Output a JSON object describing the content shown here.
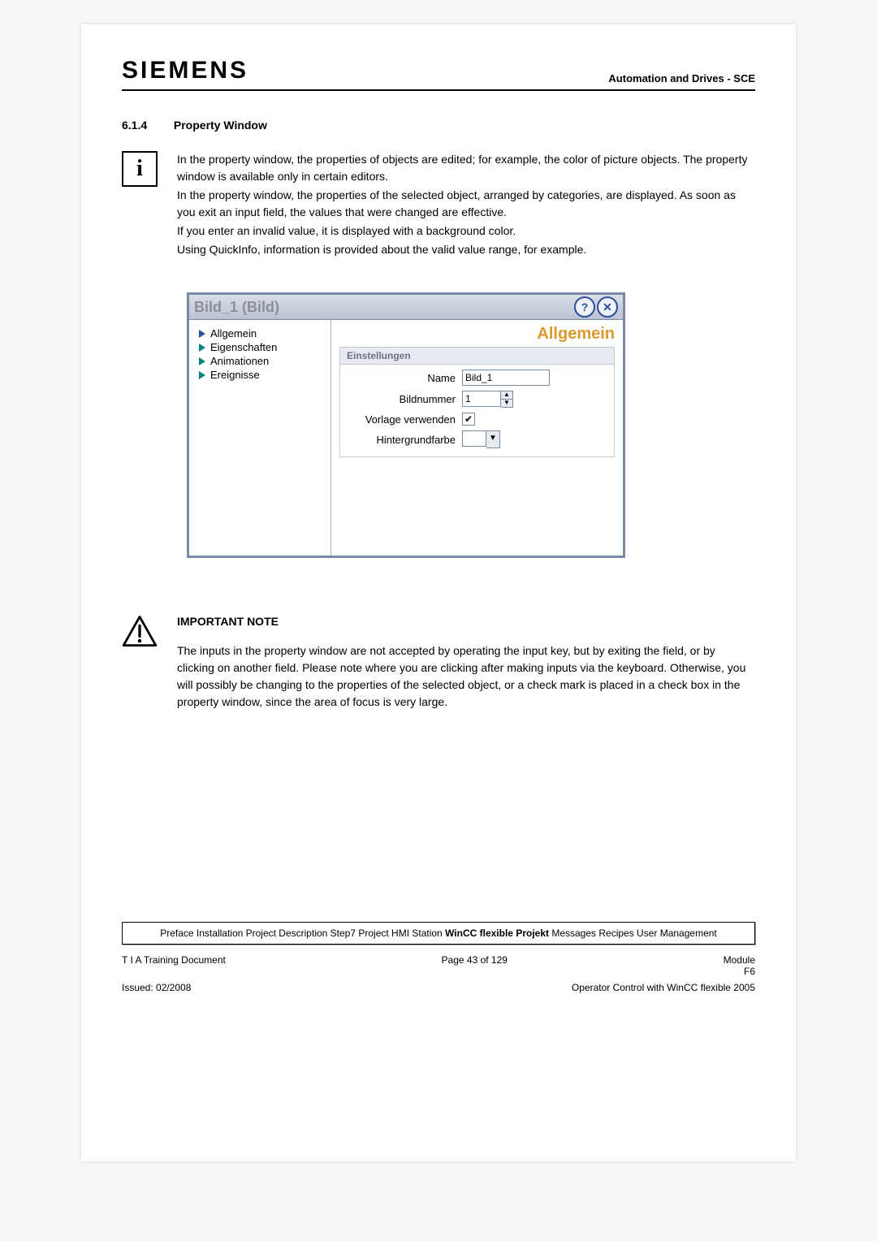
{
  "header": {
    "logo": "SIEMENS",
    "right": "Automation and Drives - SCE"
  },
  "section": {
    "number": "6.1.4",
    "title": "Property Window"
  },
  "info_icon": "i",
  "paragraphs": {
    "p1": "In the property window, the properties of objects are edited; for example, the color of picture objects. The property window is available only in certain editors.",
    "p2": "In the property window, the properties of the selected object, arranged by categories, are displayed. As soon as you exit an input field, the values that were changed are effective.",
    "p3": "If you enter an invalid value, it is displayed with a background color.",
    "p4": "Using QuickInfo, information is provided about the valid value range, for example."
  },
  "propwin": {
    "title": "Bild_1 (Bild)",
    "help_icon": "?",
    "close_icon": "✕",
    "left_items": [
      {
        "label": "Allgemein",
        "sel": true
      },
      {
        "label": "Eigenschaften",
        "sel": false
      },
      {
        "label": "Animationen",
        "sel": false
      },
      {
        "label": "Ereignisse",
        "sel": false
      }
    ],
    "right_title": "Allgemein",
    "settings_head": "Einstellungen",
    "fields": {
      "name_label": "Name",
      "name_value": "Bild_1",
      "num_label": "Bildnummer",
      "num_value": "1",
      "tpl_label": "Vorlage verwenden",
      "tpl_check": "✔",
      "bg_label": "Hintergrundfarbe"
    }
  },
  "note": {
    "title": "IMPORTANT NOTE",
    "text": "The inputs in the property window are not accepted by operating the input key, but by exiting the field, or by clicking on another field.  Please note where you are clicking after making inputs via the keyboard. Otherwise, you will possibly be changing to the properties of the selected object, or a check mark is placed in a check box in the property window, since the area of focus is very large."
  },
  "breadcrumb": {
    "pre": "Preface Installation Project Description Step7 Project HMI Station ",
    "active": "WinCC flexible Projekt",
    "post": " Messages Recipes User Management"
  },
  "footer": {
    "left1": "T I A  Training Document",
    "center1": "Page 43 of 129",
    "right1a": "Module",
    "right1b": "F6",
    "left2": "Issued: 02/2008",
    "right2": "Operator Control with WinCC flexible 2005"
  }
}
